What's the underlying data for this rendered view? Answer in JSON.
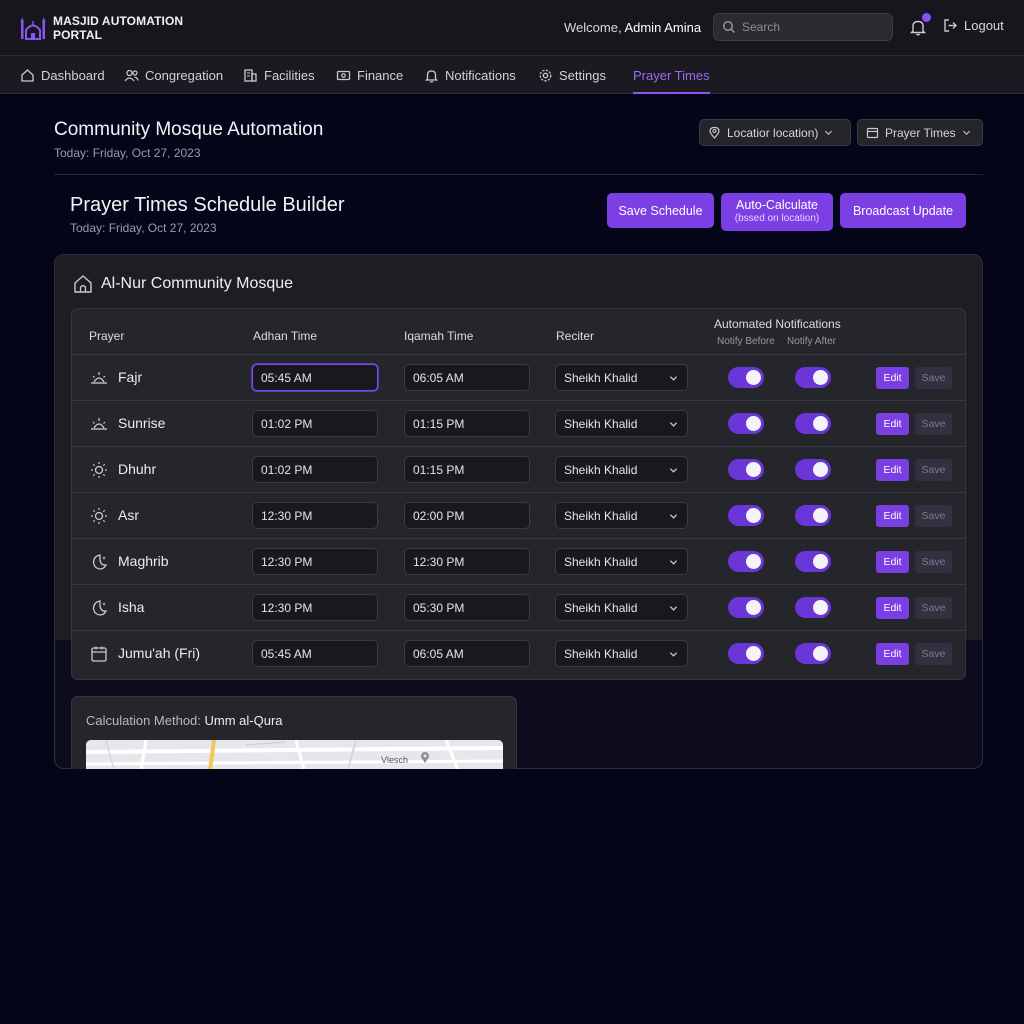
{
  "header": {
    "brand_line1": "MASJID AUTOMATION",
    "brand_line2": "PORTAL",
    "welcome_prefix": "Welcome, ",
    "user_name": "Admin Amina",
    "search_placeholder": "Search",
    "logout_label": "Logout"
  },
  "nav": {
    "items": [
      {
        "label": "Dashboard",
        "icon": "home-icon"
      },
      {
        "label": "Congregation",
        "icon": "users-icon"
      },
      {
        "label": "Facilities",
        "icon": "building-icon"
      },
      {
        "label": "Finance",
        "icon": "money-icon"
      },
      {
        "label": "Notifications",
        "icon": "bell-icon"
      },
      {
        "label": "Settings",
        "icon": "gear-icon"
      },
      {
        "label": "Prayer Times",
        "icon": "",
        "active": true
      }
    ]
  },
  "page": {
    "title": "Community Mosque Automation",
    "date": "Today: Friday, Oct 27, 2023",
    "location_dropdown": "Locatior location)",
    "view_dropdown": "Prayer Times"
  },
  "builder": {
    "title": "Prayer Times Schedule Builder",
    "date": "Today: Friday, Oct 27, 2023",
    "save_label": "Save Schedule",
    "auto_label": "Auto-Calculate",
    "auto_sub": "(bssed on location)",
    "broadcast_label": "Broadcast Update"
  },
  "mosque": {
    "name": "Al-Nur Community Mosque"
  },
  "table": {
    "headers": {
      "prayer": "Prayer",
      "adhan": "Adhan Time",
      "iqamah": "Iqamah Time",
      "reciter": "Reciter",
      "notifications": "Automated Notifications",
      "notify_before": "Notify Before",
      "notify_after": "Notify After"
    },
    "edit_label": "Edit",
    "save_label": "Save",
    "rows": [
      {
        "name": "Fajr",
        "icon": "sunrise-icon",
        "adhan": "05:45 AM",
        "iqamah": "06:05 AM",
        "reciter": "Sheikh Khalid",
        "before": true,
        "after": true
      },
      {
        "name": "Sunrise",
        "icon": "sunrise-icon",
        "adhan": "01:02 PM",
        "iqamah": "01:15 PM",
        "reciter": "Sheikh Khalid",
        "before": true,
        "after": true
      },
      {
        "name": "Dhuhr",
        "icon": "sun-icon",
        "adhan": "01:02 PM",
        "iqamah": "01:15 PM",
        "reciter": "Sheikh Khalid",
        "before": true,
        "after": true
      },
      {
        "name": "Asr",
        "icon": "sun-icon",
        "adhan": "12:30 PM",
        "iqamah": "02:00 PM",
        "reciter": "Sheikh Khalid",
        "before": true,
        "after": true
      },
      {
        "name": "Maghrib",
        "icon": "moon-icon",
        "adhan": "12:30 PM",
        "iqamah": "12:30 PM",
        "reciter": "Sheikh Khalid",
        "before": true,
        "after": true
      },
      {
        "name": "Isha",
        "icon": "moon-icon",
        "adhan": "12:30 PM",
        "iqamah": "05:30 PM",
        "reciter": "Sheikh Khalid",
        "before": true,
        "after": true
      },
      {
        "name": "Jumu'ah (Fri)",
        "icon": "calendar-icon",
        "adhan": "05:45 AM",
        "iqamah": "06:05 AM",
        "reciter": "Sheikh Khalid",
        "before": true,
        "after": true
      }
    ]
  },
  "calculation": {
    "label": "Calculation Method: ",
    "method": "Umm al-Qura",
    "map_text": "Vlesch"
  },
  "colors": {
    "accent": "#7c3fe4",
    "background": "#050519",
    "panel": "#1d1d23"
  }
}
